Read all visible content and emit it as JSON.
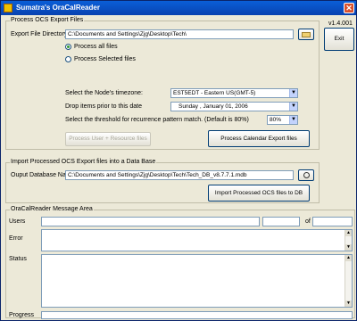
{
  "window": {
    "title": "Sumatra's OraCalReader"
  },
  "version": "v1.4.001",
  "exit_label": "Exit",
  "export_group": {
    "label": "Process OCS Export Files",
    "dir_label": "Export File Directory:",
    "dir_value": "C:\\Documents and Settings\\Zjg\\Desktop\\Tech\\",
    "radio_all": "Process all files",
    "radio_selected": "Process Selected files",
    "tz_label": "Select the Node's timezone:",
    "tz_value": "EST5EDT - Eastern US(GMT-5)",
    "date_label": "Drop items prior to this date",
    "date_value": "Sunday    ,  January   01, 2006",
    "threshold_label": "Select the threshold for recurrence pattern match. (Default is 80%)",
    "threshold_value": "80%",
    "btn_user_resource": "Process User + Resource files",
    "btn_calendar": "Process Calendar Export files"
  },
  "import_group": {
    "label": "Import Processed OCS Export files into a Data Base",
    "db_label": "Ouput Database Name",
    "db_value": "C:\\Documents and Settings\\Zjg\\Desktop\\Tech\\Tech_DB_v8.7.7.1.mdb",
    "btn_import": "Import Processed OCS files to DB"
  },
  "message_group": {
    "label": "OraCalReader Message Area",
    "users_label": "Users",
    "of_label": "of",
    "error_label": "Error",
    "status_label": "Status",
    "progress_label": "Progress"
  }
}
